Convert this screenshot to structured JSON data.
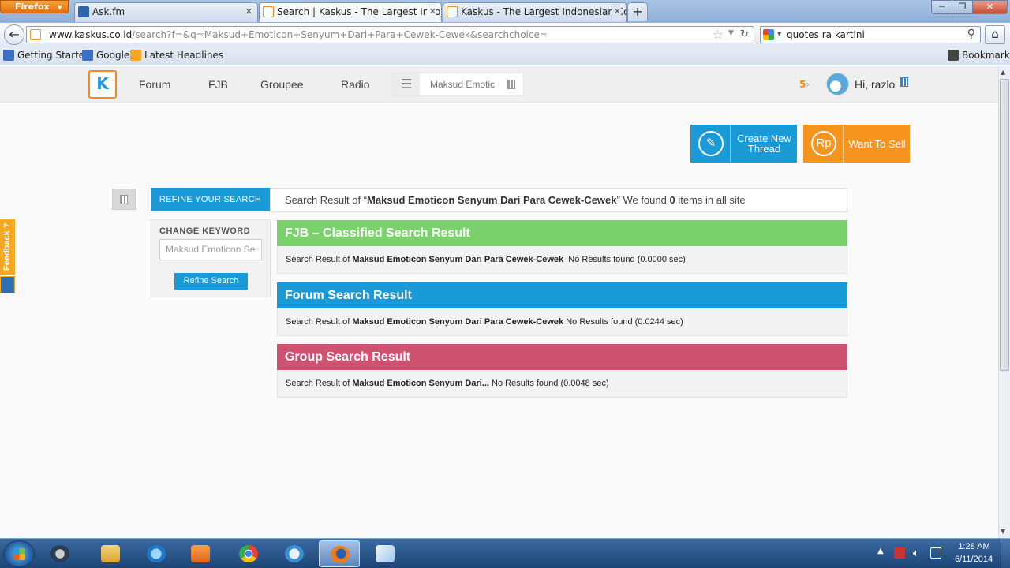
{
  "browser": {
    "menu_label": "Firefox",
    "tabs": [
      {
        "title": "Ask.fm",
        "favicon_color": "#2f64a8"
      },
      {
        "title": "Search | Kaskus - The Largest Indones...",
        "favicon_color": "#f18b21"
      },
      {
        "title": "Kaskus - The Largest Indonesian Com...",
        "favicon_color": "#f18b21"
      }
    ],
    "new_tab_label": "+",
    "url_host": "www.kaskus.co.id",
    "url_path": "/search?f=&q=Maksud+Emoticon+Senyum+Dari+Para+Cewek-Cewek&searchchoice=",
    "search_query": "quotes ra kartini",
    "bookmarks": [
      {
        "label": "Getting Started"
      },
      {
        "label": "Google"
      },
      {
        "label": "Latest Headlines"
      }
    ],
    "bookmarks_menu_label": "Bookmarks"
  },
  "header": {
    "logo_text": "K",
    "nav": [
      "Forum",
      "FJB",
      "Groupee",
      "Radio"
    ],
    "search_text": "Maksud Emotic",
    "notification_count": "5",
    "greeting": "Hi, razlo"
  },
  "actions": {
    "create_thread": "Create New Thread",
    "create_thread_icon": "pencil-icon",
    "want_to_sell": "Want To Sell",
    "want_to_sell_icon_text": "Rp"
  },
  "search": {
    "refine_tab": "REFINE YOUR SEARCH",
    "summary_prefix": "Search Result of “",
    "query": "Maksud Emoticon Senyum Dari Para Cewek-Cewek",
    "summary_middle": "” We found ",
    "count": "0",
    "summary_suffix": " items in all site",
    "change_keyword_label": "CHANGE KEYWORD",
    "keyword_value": "Maksud Emoticon Se",
    "refine_button": "Refine Search"
  },
  "results": [
    {
      "title": "FJB – Classified Search Result",
      "prefix": "Search Result of ",
      "query": "Maksud Emoticon Senyum Dari Para Cewek-Cewek",
      "status": "  No Results found (0.0000 sec)",
      "color": "#7bd16b"
    },
    {
      "title": "Forum Search Result",
      "prefix": "Search Result of ",
      "query": "Maksud Emoticon Senyum Dari Para Cewek-Cewek",
      "status": " No Results found (0.0244 sec)",
      "color": "#1a9ad6"
    },
    {
      "title": "Group Search Result",
      "prefix": "Search Result of ",
      "query": "Maksud Emoticon Senyum Dari...",
      "status": " No Results found (0.0048 sec)",
      "color": "#d05272"
    }
  ],
  "feedback_label": "Feedback ?",
  "taskbar": {
    "apps": [
      "steam-icon",
      "file-explorer-icon",
      "internet-explorer-icon",
      "media-player-icon",
      "chrome-icon",
      "app-icon",
      "firefox-icon",
      "paint-icon"
    ],
    "time": "1:28 AM",
    "date": "6/11/2014"
  }
}
